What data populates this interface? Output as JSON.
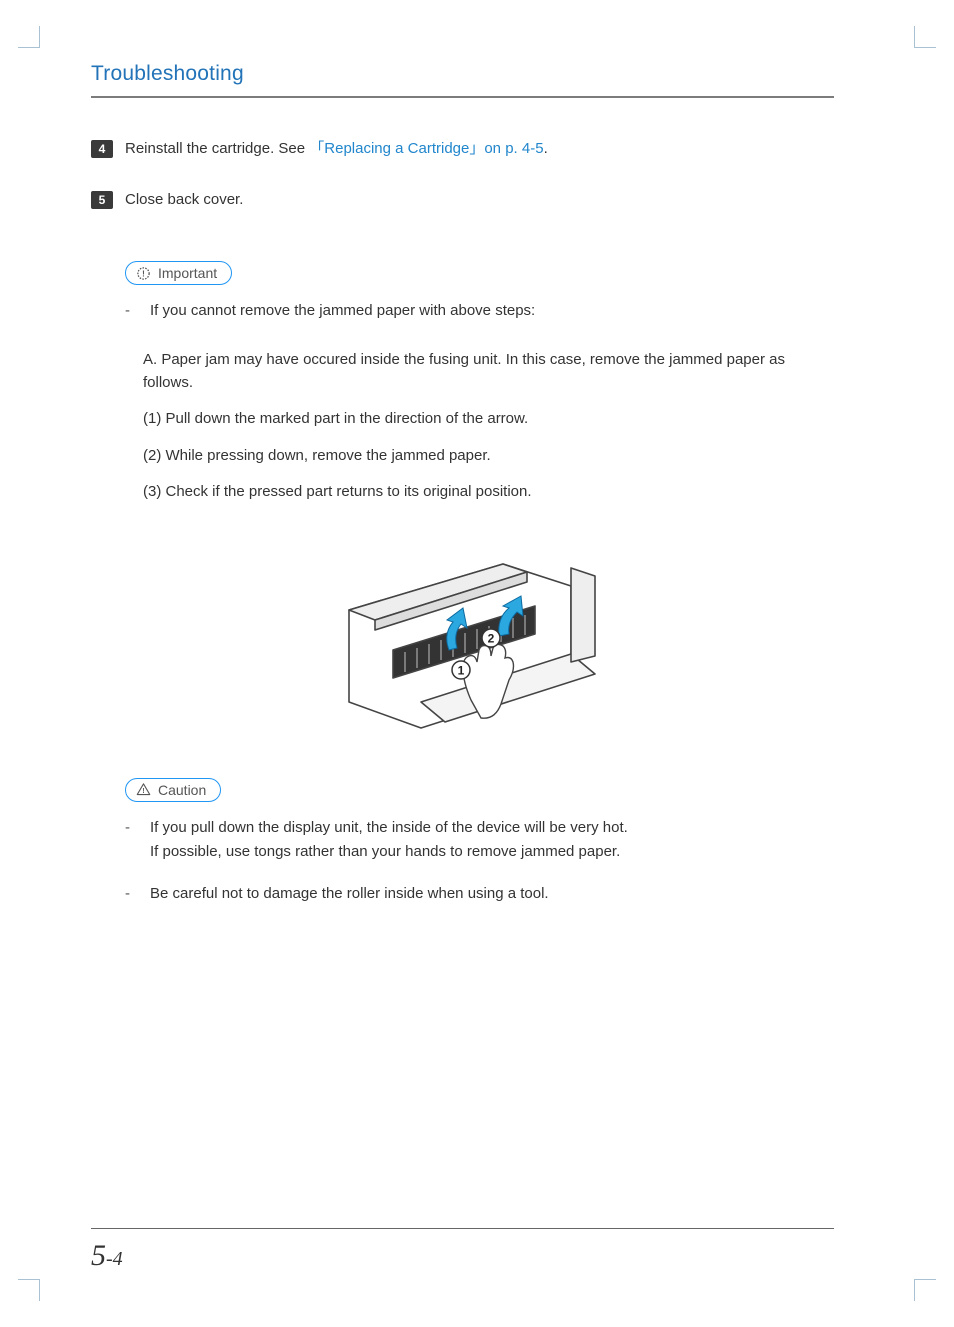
{
  "header": {
    "title": "Troubleshooting"
  },
  "steps": [
    {
      "num": "4",
      "prefix": "Reinstall the cartridge. See ",
      "link": "「Replacing a Cartridge」on p. 4-5",
      "suffix": "."
    },
    {
      "num": "5",
      "text": "Close back cover."
    }
  ],
  "callouts": {
    "important_label": "Important",
    "caution_label": "Caution"
  },
  "important": {
    "item1": "If you cannot remove the jammed paper with above steps:",
    "subA": "A. Paper jam may have occured inside the fusing unit. In this case, remove the jammed paper as follows.",
    "sub1": "(1) Pull down the marked part in the direction of the arrow.",
    "sub2": "(2) While pressing down, remove the jammed paper.",
    "sub3": "(3) Check if the pressed part returns to its original position."
  },
  "caution": {
    "item1_line1": "If you pull down the display unit, the inside of the device will be very hot.",
    "item1_line2": "If possible, use tongs rather than your hands to remove jammed paper.",
    "item2": "Be careful not to damage the roller inside when using a tool."
  },
  "page_number": {
    "major": "5",
    "sep": "-",
    "minor": "4"
  }
}
